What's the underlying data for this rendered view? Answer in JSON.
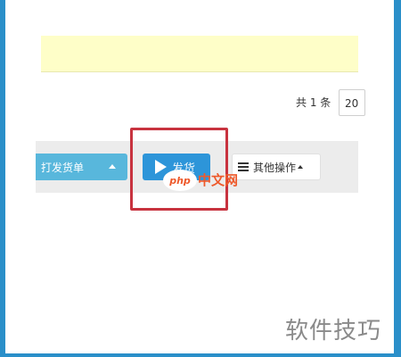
{
  "pager": {
    "total_text": "共 1 条",
    "page_size_value": "20"
  },
  "toolbar": {
    "dropdown_label": "打发货单",
    "ship_label": "发货",
    "more_label": "其他操作"
  },
  "watermarks": {
    "php_logo_text": "php",
    "cn_text": "中文网",
    "skill_text": "软件技巧"
  },
  "colors": {
    "frame": "#2a8fc9",
    "notice_bg": "#fefec8",
    "toolbar_bg": "#ececec",
    "dropdown_bg": "#58b7dc",
    "ship_bg": "#2d95d9",
    "highlight": "#c8333f",
    "watermark_php": "#ee5a2c"
  }
}
